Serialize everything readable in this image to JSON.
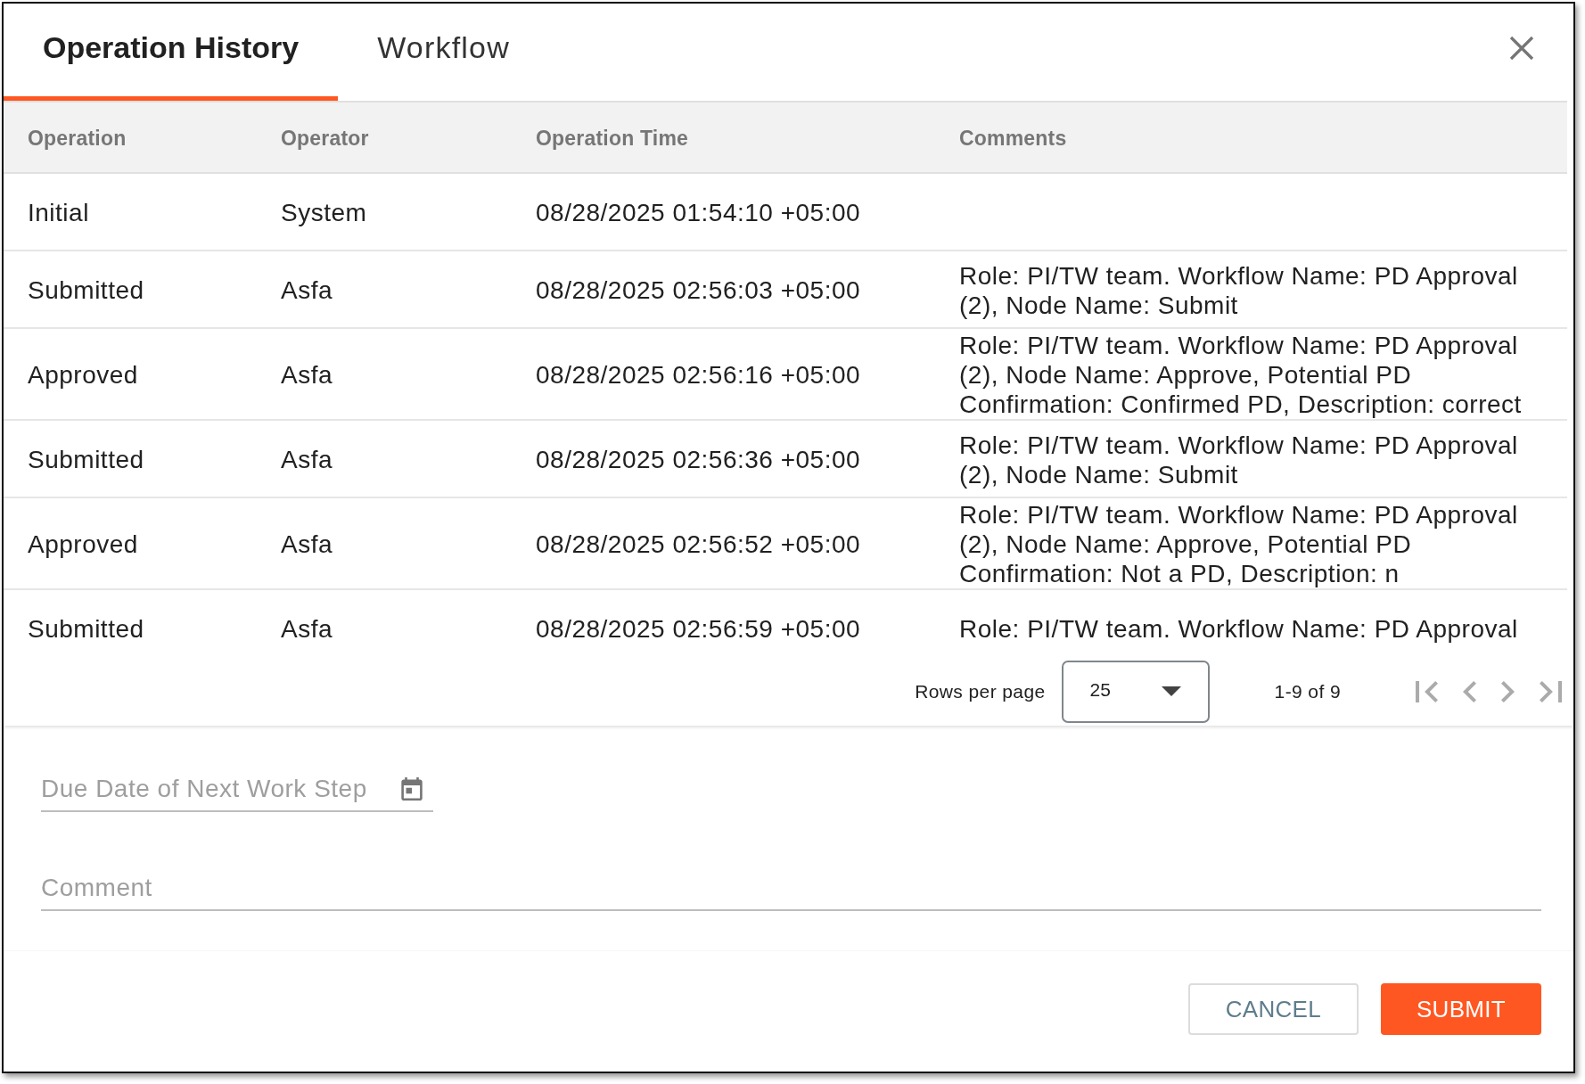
{
  "dialog": {
    "tabs": [
      {
        "label": "Operation History",
        "selected": true
      },
      {
        "label": "Workflow",
        "selected": false
      }
    ],
    "table": {
      "columns": [
        "Operation",
        "Operator",
        "Operation Time",
        "Comments"
      ],
      "rows": [
        {
          "cells": [
            "Initial",
            "System",
            "08/28/2025 01:54:10 +05:00"
          ]
        },
        {
          "cells": [
            "Submitted",
            "Asfa",
            "08/28/2025 02:56:03 +05:00",
            "Role: PI/TW team. Workflow Name: PD Approval (2), Node Name: Submit"
          ]
        },
        {
          "cells": [
            "Approved",
            "Asfa",
            "08/28/2025 02:56:16 +05:00",
            "Role: PI/TW team. Workflow Name: PD Approval (2), Node Name: Approve, Potential PD Confirmation: Confirmed PD, Description: correct"
          ]
        },
        {
          "cells": [
            "Submitted",
            "Asfa",
            "08/28/2025 02:56:36 +05:00",
            "Role: PI/TW team. Workflow Name: PD Approval (2), Node Name: Submit"
          ]
        },
        {
          "cells": [
            "Approved",
            "Asfa",
            "08/28/2025 02:56:52 +05:00",
            "Role: PI/TW team. Workflow Name: PD Approval (2), Node Name: Approve, Potential PD Confirmation: Not a PD, Description: n"
          ]
        },
        {
          "cells": [
            "Submitted",
            "Asfa",
            "08/28/2025 02:56:59 +05:00",
            "Role: PI/TW team. Workflow Name: PD Approval"
          ]
        }
      ]
    },
    "pagination": {
      "label": "Rows per page",
      "rows_per_page": "25",
      "range": "1-9 of 9",
      "nav": [
        {
          "kind": "first",
          "disabled": true
        },
        {
          "kind": "previous",
          "disabled": true
        },
        {
          "kind": "next",
          "disabled": true
        },
        {
          "kind": "last",
          "disabled": true
        }
      ]
    },
    "form": {
      "due_date": {
        "placeholder": "Due Date of Next Work Step"
      },
      "comment": {
        "placeholder": "Comment"
      }
    },
    "buttons": [
      {
        "label": "CANCEL",
        "kind": "secondary"
      },
      {
        "label": "SUBMIT",
        "kind": "primary"
      }
    ]
  }
}
